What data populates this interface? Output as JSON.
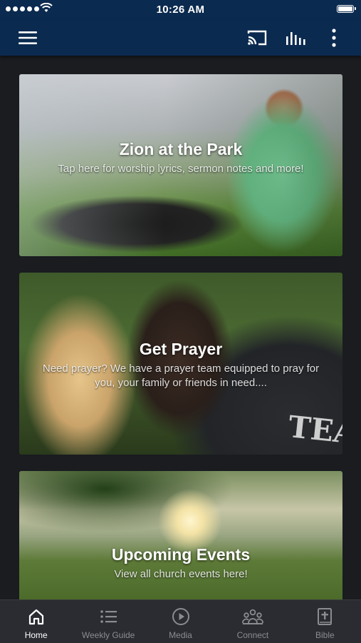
{
  "status_bar": {
    "time": "10:26 AM"
  },
  "app_bar": {
    "menu_icon": "hamburger-menu-icon",
    "actions": [
      "cast-icon",
      "audio-bars-icon",
      "more-vertical-icon"
    ]
  },
  "cards": [
    {
      "title": "Zion at the Park",
      "subtitle": "Tap here for worship lyrics, sermon notes and more!"
    },
    {
      "title": "Get Prayer",
      "subtitle": "Need prayer? We have a prayer team equipped to pray for you, your family or friends in need...."
    },
    {
      "title": "Upcoming Events",
      "subtitle": "View all church events here!"
    }
  ],
  "tabs": [
    {
      "label": "Home",
      "icon": "home-icon",
      "active": true
    },
    {
      "label": "Weekly Guide",
      "icon": "list-icon",
      "active": false
    },
    {
      "label": "Media",
      "icon": "play-icon",
      "active": false
    },
    {
      "label": "Connect",
      "icon": "people-icon",
      "active": false
    },
    {
      "label": "Bible",
      "icon": "bible-icon",
      "active": false
    }
  ],
  "colors": {
    "header_bg": "#0b2a4f",
    "page_bg": "#1a1c20",
    "tab_bar_bg": "#2a2c31",
    "tab_active": "#ffffff",
    "tab_inactive": "#8a8c90"
  }
}
